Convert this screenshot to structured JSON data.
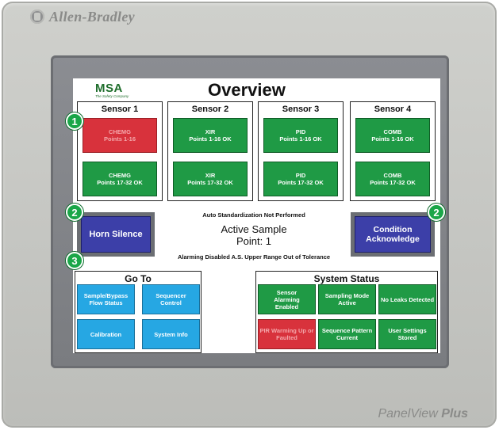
{
  "bezel": {
    "brand": "Allen-Bradley",
    "model_prefix": "PanelView",
    "model_suffix": "Plus",
    "logo_icon": "allen-bradley-logo-icon"
  },
  "header": {
    "logo_text": "MSA",
    "logo_tagline": "The Safety Company",
    "title": "Overview"
  },
  "sensors": [
    {
      "name": "Sensor 1",
      "tiles": [
        {
          "line1": "CHEMG",
          "line2": "Points 1-16",
          "state": "alarm"
        },
        {
          "line1": "CHEMG",
          "line2": "Points 17-32 OK",
          "state": "ok"
        }
      ]
    },
    {
      "name": "Sensor 2",
      "tiles": [
        {
          "line1": "XIR",
          "line2": "Points 1-16 OK",
          "state": "ok"
        },
        {
          "line1": "XIR",
          "line2": "Points 17-32 OK",
          "state": "ok"
        }
      ]
    },
    {
      "name": "Sensor 3",
      "tiles": [
        {
          "line1": "PID",
          "line2": "Points 1-16 OK",
          "state": "ok"
        },
        {
          "line1": "PID",
          "line2": "Points 17-32 OK",
          "state": "ok"
        }
      ]
    },
    {
      "name": "Sensor 4",
      "tiles": [
        {
          "line1": "COMB",
          "line2": "Points 1-16 OK",
          "state": "ok"
        },
        {
          "line1": "COMB",
          "line2": "Points 17-32 OK",
          "state": "ok"
        }
      ]
    }
  ],
  "middle": {
    "horn_label": "Horn Silence",
    "condition_line1": "Condition",
    "condition_line2": "Acknowledge",
    "auto_std": "Auto Standardization Not Performed",
    "active_line1": "Active Sample",
    "active_line2": "Point: 1",
    "alarm_msg": "Alarming Disabled A.S. Upper Range Out of Tolerance"
  },
  "goto": {
    "header": "Go To",
    "buttons": [
      {
        "line1": "Sample/Bypass",
        "line2": "Flow Status"
      },
      {
        "line1": "Sequencer",
        "line2": "Control"
      },
      {
        "line1": "Calibration",
        "line2": ""
      },
      {
        "line1": "System Info",
        "line2": ""
      }
    ]
  },
  "system_status": {
    "header": "System Status",
    "tiles": [
      {
        "line1": "Sensor",
        "line2": "Alarming",
        "line3": "Enabled",
        "state": "ok"
      },
      {
        "line1": "Sampling Mode",
        "line2": "Active",
        "line3": "",
        "state": "ok"
      },
      {
        "line1": "No Leaks Detected",
        "line2": "",
        "line3": "",
        "state": "ok"
      },
      {
        "line1": "PIR Warming Up or",
        "line2": "Faulted",
        "line3": "",
        "state": "warn"
      },
      {
        "line1": "Sequence Pattern",
        "line2": "Current",
        "line3": "",
        "state": "ok"
      },
      {
        "line1": "User Settings",
        "line2": "Stored",
        "line3": "",
        "state": "ok"
      }
    ]
  },
  "callouts": [
    "1",
    "2",
    "2",
    "3"
  ],
  "colors": {
    "ok": "#1f9a45",
    "alarm": "#d8323c",
    "nav": "#26a7e3",
    "action": "#3c3fa8",
    "callout": "#1aa648"
  }
}
